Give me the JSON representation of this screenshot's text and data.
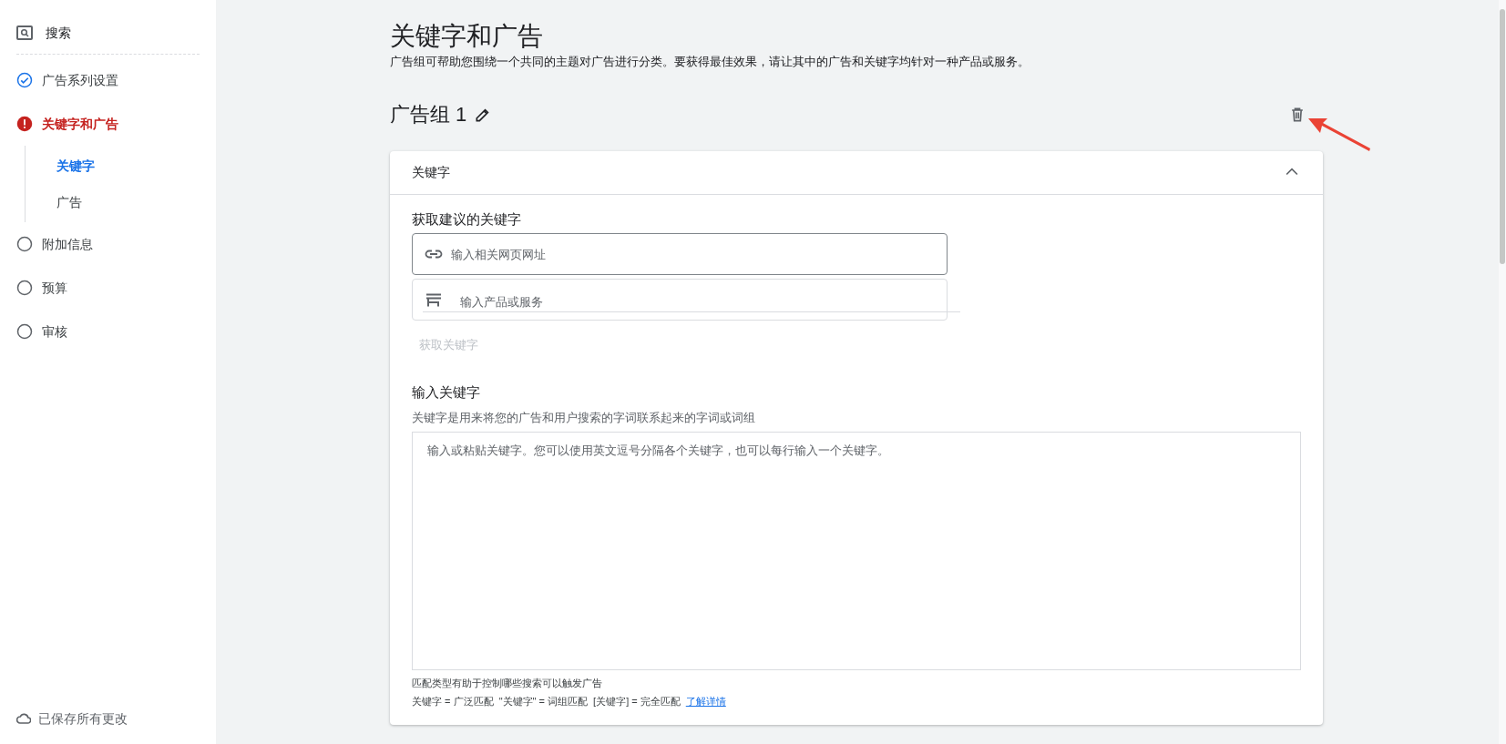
{
  "sidebar": {
    "header": {
      "label": "搜索"
    },
    "steps": [
      {
        "label": "广告系列设置",
        "kind": "done"
      },
      {
        "label": "关键字和广告",
        "kind": "error",
        "children": [
          {
            "label": "关键字",
            "selected": true
          },
          {
            "label": "广告",
            "selected": false
          }
        ]
      },
      {
        "label": "附加信息",
        "kind": "pending"
      },
      {
        "label": "预算",
        "kind": "pending"
      },
      {
        "label": "审核",
        "kind": "pending"
      }
    ],
    "save_status": "已保存所有更改"
  },
  "page": {
    "title": "关键字和广告",
    "description": "广告组可帮助您围绕一个共同的主题对广告进行分类。要获得最佳效果，请让其中的广告和关键字均针对一种产品或服务。",
    "ad_group": {
      "name": "广告组 1"
    },
    "panel": {
      "title": "关键字",
      "expanded": true,
      "suggest_title": "获取建议的关键字",
      "url_field": {
        "placeholder": "输入相关网页网址"
      },
      "product_field": {
        "placeholder": "输入产品或服务"
      },
      "get_button": {
        "label": "获取关键字",
        "disabled": true
      },
      "enter_title": "输入关键字",
      "enter_help": "关键字是用来将您的广告和用户搜索的字词联系起来的字词或词组",
      "keywords_field": {
        "placeholder": "输入或粘贴关键字。您可以使用英文逗号分隔各个关键字，也可以每行输入一个关键字。"
      },
      "match_help": "匹配类型有助于控制哪些搜索可以触发广告",
      "match_types": "关键字 = 广泛匹配  \"关键字\" = 词组匹配  [关键字] = 完全匹配",
      "learn_more": "了解详情"
    }
  }
}
